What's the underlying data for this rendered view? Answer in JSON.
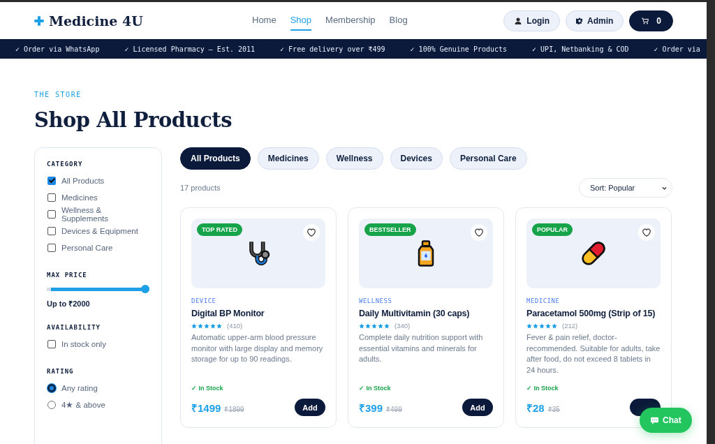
{
  "header": {
    "logo": "Medicine 4U",
    "nav": [
      {
        "label": "Home",
        "selected": false
      },
      {
        "label": "Shop",
        "selected": true
      },
      {
        "label": "Membership",
        "selected": false
      },
      {
        "label": "Blog",
        "selected": false
      }
    ],
    "login": "Login",
    "admin": "Admin",
    "cart_count": "0"
  },
  "ticker": [
    "✓ Order via WhatsApp",
    "✓ Licensed Pharmacy — Est. 2011",
    "✓ Free delivery over ₹499",
    "✓ 100% Genuine Products",
    "✓ UPI, Netbanking & COD",
    "✓ Order via"
  ],
  "eyebrow": "THE STORE",
  "heading": "Shop All Products",
  "filters": {
    "category": {
      "title": "CATEGORY",
      "options": [
        {
          "label": "All Products",
          "checked": true
        },
        {
          "label": "Medicines",
          "checked": false
        },
        {
          "label": "Wellness & Supplements",
          "checked": false
        },
        {
          "label": "Devices & Equipment",
          "checked": false
        },
        {
          "label": "Personal Care",
          "checked": false
        }
      ]
    },
    "price": {
      "title": "MAX PRICE",
      "level": 1,
      "reading": "Up to ₹2000"
    },
    "availability": {
      "title": "AVAILABILITY",
      "options": [
        {
          "label": "In stock only",
          "checked": false
        }
      ]
    },
    "rating": {
      "title": "RATING",
      "options": [
        {
          "label": "Any rating",
          "selected": true
        },
        {
          "label": "4★ & above",
          "selected": false
        }
      ]
    }
  },
  "chips": [
    {
      "label": "All Products",
      "selected": true
    },
    {
      "label": "Medicines",
      "selected": false
    },
    {
      "label": "Wellness",
      "selected": false
    },
    {
      "label": "Devices",
      "selected": false
    },
    {
      "label": "Personal Care",
      "selected": false
    }
  ],
  "count": "17 products",
  "sort": "Sort: Popular",
  "products": [
    {
      "kind": "stethoscope",
      "badge": "TOP RATED",
      "category": "DEVICE",
      "name": "Digital BP Monitor",
      "stars": 5,
      "reviews": "(410)",
      "description": "Automatic upper-arm blood pressure monitor with large display and memory storage for up to 90 readings.",
      "stock": "✓ In Stock",
      "price": "₹1499",
      "old_price": "₹1899",
      "add": "Add"
    },
    {
      "kind": "bottle",
      "badge": "BESTSELLER",
      "category": "WELLNESS",
      "name": "Daily Multivitamin (30 caps)",
      "stars": 5,
      "reviews": "(340)",
      "description": "Complete daily nutrition support with essential vitamins and minerals for adults.",
      "stock": "✓ In Stock",
      "price": "₹399",
      "old_price": "₹499",
      "add": "Add"
    },
    {
      "kind": "pill",
      "badge": "POPULAR",
      "category": "MEDICINE",
      "name": "Paracetamol 500mg (Strip of 15)",
      "stars": 5,
      "reviews": "(212)",
      "description": "Fever & pain relief, doctor-recommended. Suitable for adults, take after food, do not exceed 8 tablets in 24 hours.",
      "stock": "✓ In Stock",
      "price": "₹28",
      "old_price": "₹35"
    }
  ],
  "chat": "Chat"
}
